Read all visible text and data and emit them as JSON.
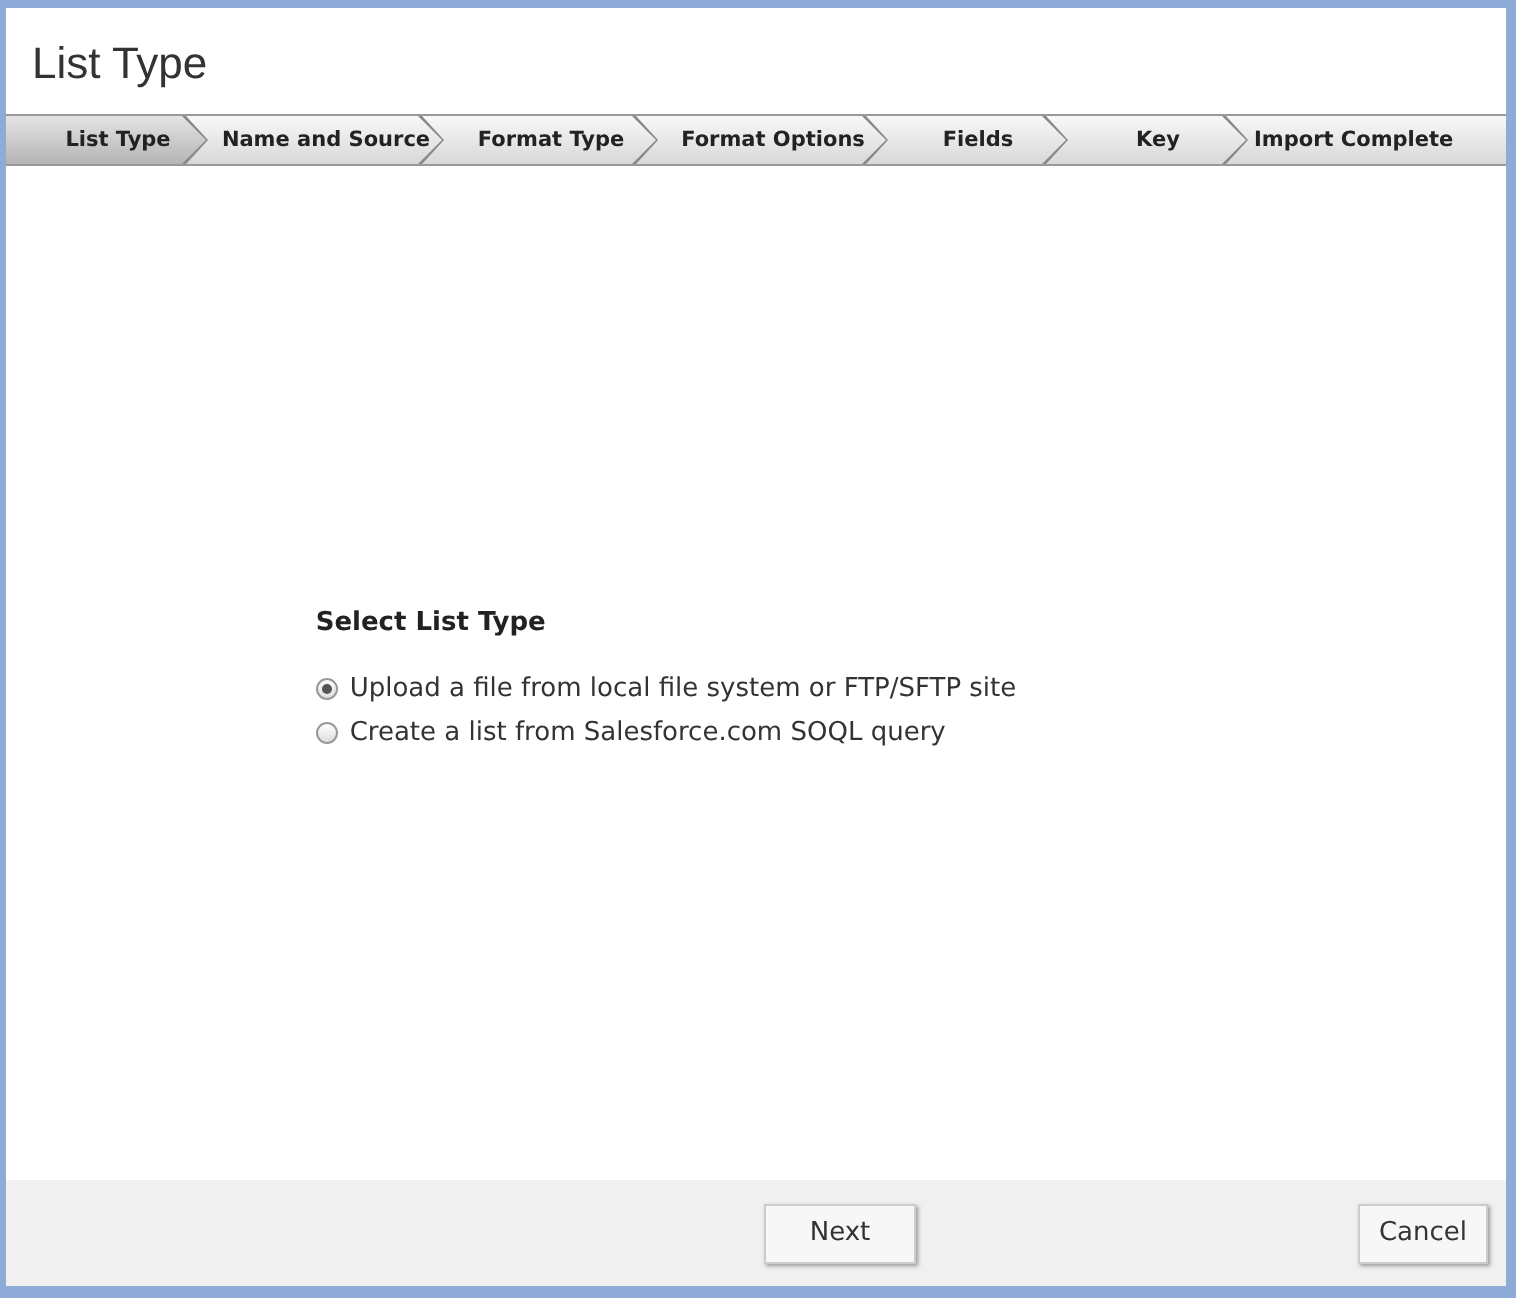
{
  "window": {
    "title": "List Type"
  },
  "steps": [
    {
      "label": "List Type",
      "selected": true
    },
    {
      "label": "Name and Source",
      "selected": false
    },
    {
      "label": "Format Type",
      "selected": false
    },
    {
      "label": "Format Options",
      "selected": false
    },
    {
      "label": "Fields",
      "selected": false
    },
    {
      "label": "Key",
      "selected": false
    },
    {
      "label": "Import Complete",
      "selected": false
    }
  ],
  "form": {
    "heading": "Select List Type",
    "options": [
      {
        "label": "Upload a file from local file system or FTP/SFTP site",
        "selected": true
      },
      {
        "label": "Create a list from Salesforce.com SOQL query",
        "selected": false
      }
    ]
  },
  "buttons": {
    "next": "Next",
    "cancel": "Cancel"
  }
}
